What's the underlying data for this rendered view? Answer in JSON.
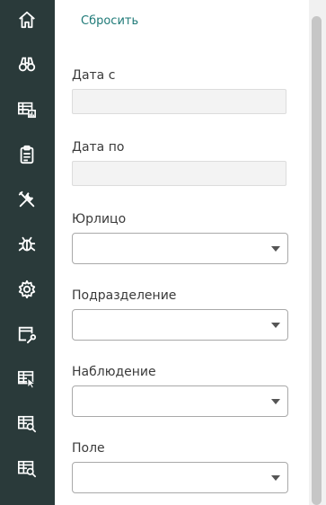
{
  "sidebar": {
    "items": [
      {
        "icon": "home-icon"
      },
      {
        "icon": "binoculars-icon"
      },
      {
        "icon": "table-chart-icon"
      },
      {
        "icon": "clipboard-icon"
      },
      {
        "icon": "tools-icon"
      },
      {
        "icon": "bug-icon"
      },
      {
        "icon": "gear-icon"
      },
      {
        "icon": "window-wrench-icon"
      },
      {
        "icon": "table-cursor-icon"
      },
      {
        "icon": "table-search-icon"
      },
      {
        "icon": "table-search-icon"
      }
    ]
  },
  "filters": {
    "reset_label": "Сбросить",
    "date_from": {
      "label": "Дата с",
      "value": ""
    },
    "date_to": {
      "label": "Дата по",
      "value": ""
    },
    "legal_entity": {
      "label": "Юрлицо",
      "value": ""
    },
    "department": {
      "label": "Подразделение",
      "value": ""
    },
    "observation": {
      "label": "Наблюдение",
      "value": ""
    },
    "field": {
      "label": "Поле",
      "value": ""
    }
  },
  "colors": {
    "sidebar_bg": "#2a3a3a",
    "accent": "#1f7a78"
  }
}
